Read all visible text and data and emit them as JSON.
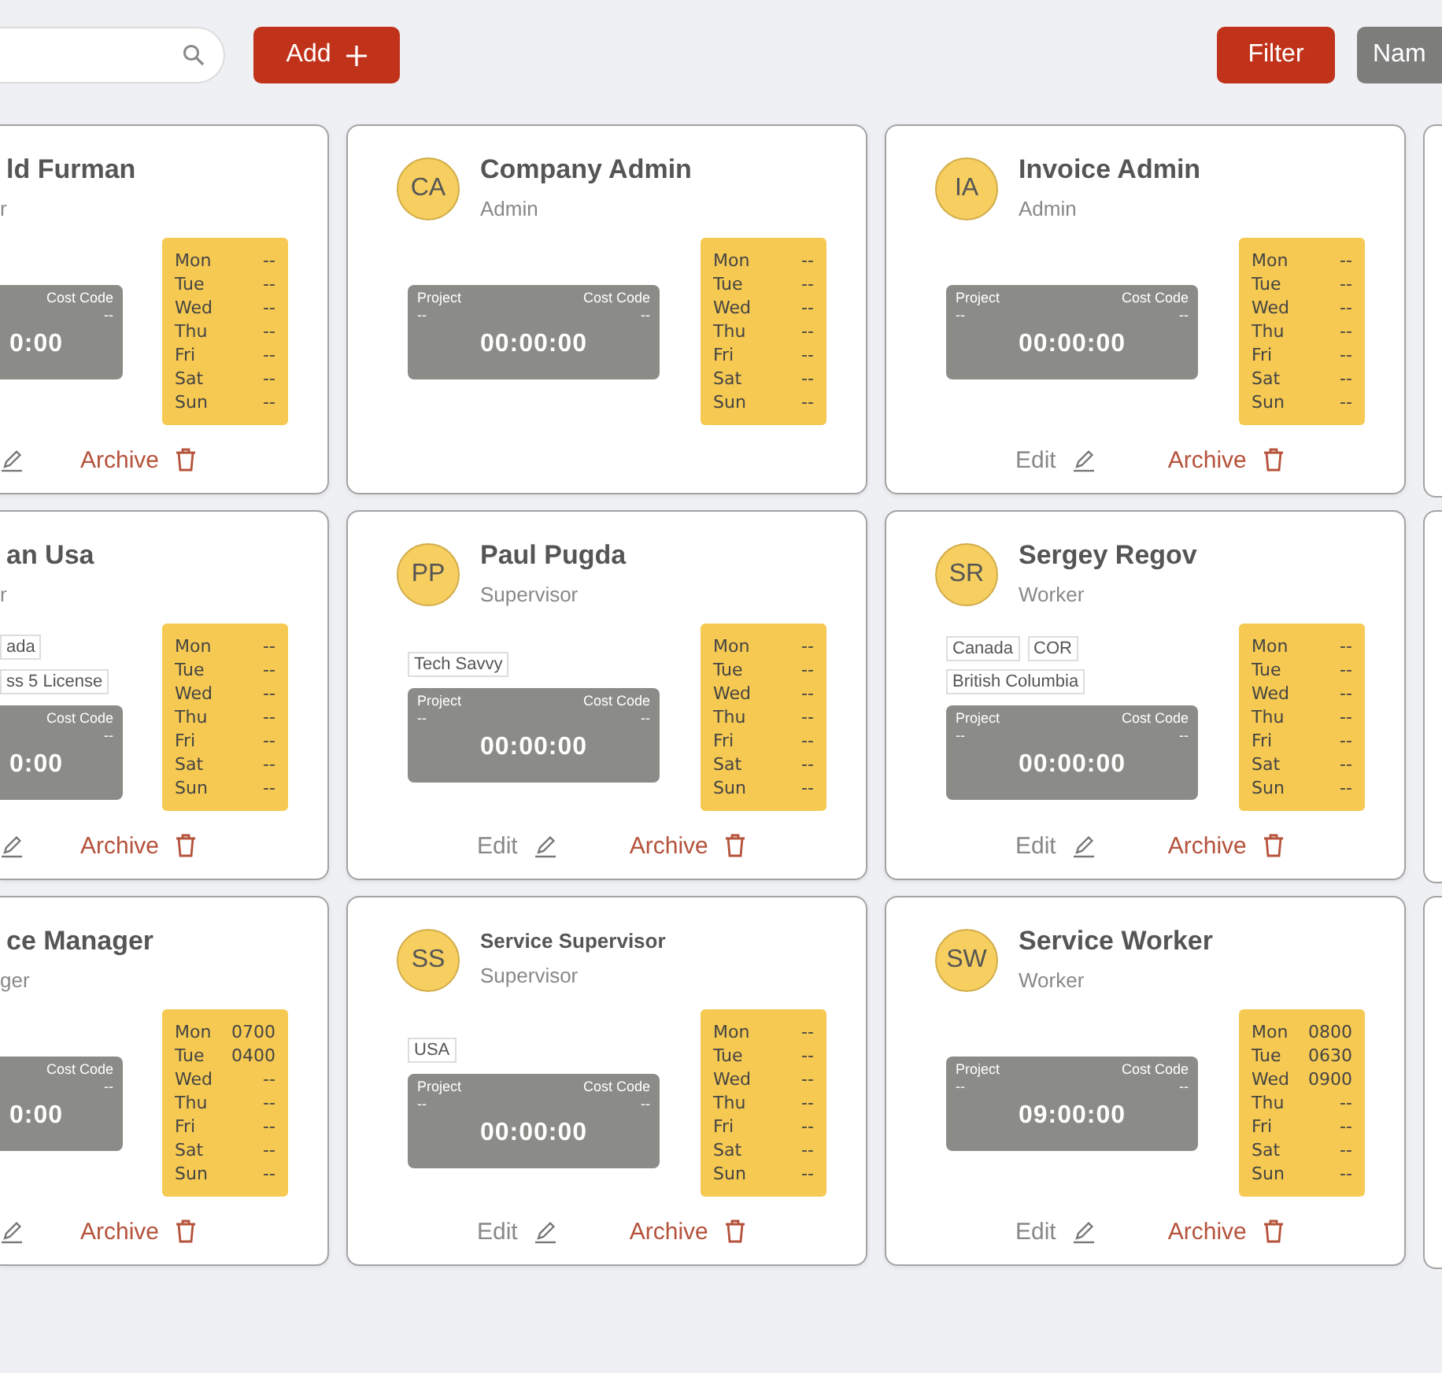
{
  "toolbar": {
    "add_button": "Add",
    "filter_button": "Filter",
    "sort_button": "Nam"
  },
  "cards": [
    {
      "clipped": true,
      "name": "ld Furman",
      "role": "r",
      "timer": {
        "cost_code_label": "Cost Code",
        "cost_code": "--",
        "time": "0:00"
      },
      "schedule": [
        {
          "day": "Mon",
          "time": "--"
        },
        {
          "day": "Tue",
          "time": "--"
        },
        {
          "day": "Wed",
          "time": "--"
        },
        {
          "day": "Thu",
          "time": "--"
        },
        {
          "day": "Fri",
          "time": "--"
        },
        {
          "day": "Sat",
          "time": "--"
        },
        {
          "day": "Sun",
          "time": "--"
        }
      ],
      "archive_label": "Archive"
    },
    {
      "clipped": false,
      "initials": "CA",
      "name": "Company Admin",
      "role": "Admin",
      "timer": {
        "project_label": "Project",
        "project": "--",
        "cost_code_label": "Cost Code",
        "cost_code": "--",
        "time": "00:00:00"
      },
      "schedule": [
        {
          "day": "Mon",
          "time": "--"
        },
        {
          "day": "Tue",
          "time": "--"
        },
        {
          "day": "Wed",
          "time": "--"
        },
        {
          "day": "Thu",
          "time": "--"
        },
        {
          "day": "Fri",
          "time": "--"
        },
        {
          "day": "Sat",
          "time": "--"
        },
        {
          "day": "Sun",
          "time": "--"
        }
      ]
    },
    {
      "clipped": false,
      "initials": "IA",
      "name": "Invoice Admin",
      "role": "Admin",
      "timer": {
        "project_label": "Project",
        "project": "--",
        "cost_code_label": "Cost Code",
        "cost_code": "--",
        "time": "00:00:00"
      },
      "schedule": [
        {
          "day": "Mon",
          "time": "--"
        },
        {
          "day": "Tue",
          "time": "--"
        },
        {
          "day": "Wed",
          "time": "--"
        },
        {
          "day": "Thu",
          "time": "--"
        },
        {
          "day": "Fri",
          "time": "--"
        },
        {
          "day": "Sat",
          "time": "--"
        },
        {
          "day": "Sun",
          "time": "--"
        }
      ],
      "edit_label": "Edit",
      "archive_label": "Archive"
    },
    {
      "clipped": true,
      "name": "an Usa",
      "role": "r",
      "tags": [
        "ada",
        "ss 5 License"
      ],
      "timer": {
        "cost_code_label": "Cost Code",
        "cost_code": "--",
        "time": "0:00"
      },
      "schedule": [
        {
          "day": "Mon",
          "time": "--"
        },
        {
          "day": "Tue",
          "time": "--"
        },
        {
          "day": "Wed",
          "time": "--"
        },
        {
          "day": "Thu",
          "time": "--"
        },
        {
          "day": "Fri",
          "time": "--"
        },
        {
          "day": "Sat",
          "time": "--"
        },
        {
          "day": "Sun",
          "time": "--"
        }
      ],
      "archive_label": "Archive"
    },
    {
      "clipped": false,
      "initials": "PP",
      "name": "Paul Pugda",
      "role": "Supervisor",
      "tags": [
        "Tech Savvy"
      ],
      "timer": {
        "project_label": "Project",
        "project": "--",
        "cost_code_label": "Cost Code",
        "cost_code": "--",
        "time": "00:00:00"
      },
      "schedule": [
        {
          "day": "Mon",
          "time": "--"
        },
        {
          "day": "Tue",
          "time": "--"
        },
        {
          "day": "Wed",
          "time": "--"
        },
        {
          "day": "Thu",
          "time": "--"
        },
        {
          "day": "Fri",
          "time": "--"
        },
        {
          "day": "Sat",
          "time": "--"
        },
        {
          "day": "Sun",
          "time": "--"
        }
      ],
      "edit_label": "Edit",
      "archive_label": "Archive"
    },
    {
      "clipped": false,
      "initials": "SR",
      "name": "Sergey Regov",
      "role": "Worker",
      "tags": [
        "Canada",
        "COR",
        "British Columbia"
      ],
      "timer": {
        "project_label": "Project",
        "project": "--",
        "cost_code_label": "Cost Code",
        "cost_code": "--",
        "time": "00:00:00"
      },
      "schedule": [
        {
          "day": "Mon",
          "time": "--"
        },
        {
          "day": "Tue",
          "time": "--"
        },
        {
          "day": "Wed",
          "time": "--"
        },
        {
          "day": "Thu",
          "time": "--"
        },
        {
          "day": "Fri",
          "time": "--"
        },
        {
          "day": "Sat",
          "time": "--"
        },
        {
          "day": "Sun",
          "time": "--"
        }
      ],
      "edit_label": "Edit",
      "archive_label": "Archive"
    },
    {
      "clipped": true,
      "name": "ce Manager",
      "role": "ger",
      "timer": {
        "cost_code_label": "Cost Code",
        "cost_code": "--",
        "time": "0:00"
      },
      "schedule": [
        {
          "day": "Mon",
          "time": "0700"
        },
        {
          "day": "Tue",
          "time": "0400"
        },
        {
          "day": "Wed",
          "time": "--"
        },
        {
          "day": "Thu",
          "time": "--"
        },
        {
          "day": "Fri",
          "time": "--"
        },
        {
          "day": "Sat",
          "time": "--"
        },
        {
          "day": "Sun",
          "time": "--"
        }
      ],
      "archive_label": "Archive"
    },
    {
      "clipped": false,
      "initials": "SS",
      "name": "Service Supervisor",
      "role": "Supervisor",
      "tags": [
        "USA"
      ],
      "timer": {
        "project_label": "Project",
        "project": "--",
        "cost_code_label": "Cost Code",
        "cost_code": "--",
        "time": "00:00:00"
      },
      "schedule": [
        {
          "day": "Mon",
          "time": "--"
        },
        {
          "day": "Tue",
          "time": "--"
        },
        {
          "day": "Wed",
          "time": "--"
        },
        {
          "day": "Thu",
          "time": "--"
        },
        {
          "day": "Fri",
          "time": "--"
        },
        {
          "day": "Sat",
          "time": "--"
        },
        {
          "day": "Sun",
          "time": "--"
        }
      ],
      "edit_label": "Edit",
      "archive_label": "Archive"
    },
    {
      "clipped": false,
      "initials": "SW",
      "name": "Service Worker",
      "role": "Worker",
      "timer": {
        "project_label": "Project",
        "project": "--",
        "cost_code_label": "Cost Code",
        "cost_code": "--",
        "time": "09:00:00"
      },
      "schedule": [
        {
          "day": "Mon",
          "time": "0800"
        },
        {
          "day": "Tue",
          "time": "0630"
        },
        {
          "day": "Wed",
          "time": "0900"
        },
        {
          "day": "Thu",
          "time": "--"
        },
        {
          "day": "Fri",
          "time": "--"
        },
        {
          "day": "Sat",
          "time": "--"
        },
        {
          "day": "Sun",
          "time": "--"
        }
      ],
      "edit_label": "Edit",
      "archive_label": "Archive"
    }
  ]
}
